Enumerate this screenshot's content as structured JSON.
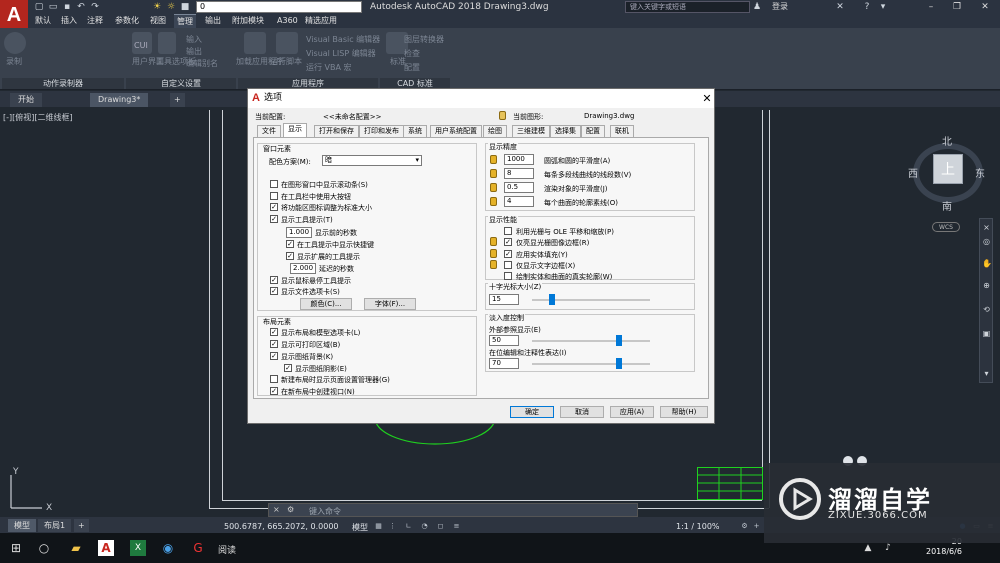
{
  "titlebar": {
    "app_title": "Autodesk AutoCAD 2018    Drawing3.dwg",
    "layer_value": "0",
    "search_placeholder": "键入关键字或短语",
    "login": "登录"
  },
  "ribbon": {
    "tabs": [
      "默认",
      "插入",
      "注释",
      "参数化",
      "视图",
      "管理",
      "输出",
      "附加模块",
      "A360",
      "精选应用"
    ],
    "active_tab": "管理",
    "items": {
      "record": "录制",
      "cui": "CUI",
      "user_interface": "用户界面",
      "tool_palettes": "工具选项板",
      "import": "输入",
      "export": "输出",
      "edit_aliases": "编辑别名",
      "load_app": "加载应用程序",
      "run_script": "运行脚本",
      "vb_editor": "Visual Basic 编辑器",
      "lisp_editor": "Visual LISP 编辑器",
      "run_vba": "运行 VBA 宏",
      "standards": "标准",
      "configure": "配置",
      "layer_translator": "图层转换器",
      "check": "检查"
    },
    "groups": [
      "动作录制器",
      "自定义设置",
      "应用程序",
      "CAD 标准"
    ]
  },
  "doc_tabs": [
    "开始",
    "Drawing3*"
  ],
  "viewport_label": "[-][俯视][二维线框]",
  "viewcube": {
    "face": "上",
    "north": "北",
    "south": "南",
    "east": "东",
    "west": "西",
    "wcs": "WCS"
  },
  "dialog": {
    "title": "选项",
    "current_profile_label": "当前配置:",
    "current_profile_value": "<<未命名配置>>",
    "current_drawing_label": "当前图形:",
    "current_drawing_value": "Drawing3.dwg",
    "tabs": [
      "文件",
      "显示",
      "打开和保存",
      "打印和发布",
      "系统",
      "用户系统配置",
      "绘图",
      "三维建模",
      "选择集",
      "配置",
      "联机"
    ],
    "active_tab": "显示",
    "window_elements": {
      "title": "窗口元素",
      "color_scheme_label": "配色方案(M):",
      "color_scheme_value": "暗",
      "checkboxes": [
        {
          "label": "在图形窗口中显示滚动条(S)",
          "checked": false
        },
        {
          "label": "在工具栏中使用大按钮",
          "checked": false
        },
        {
          "label": "将功能区图标调整为标准大小",
          "checked": true
        },
        {
          "label": "显示工具提示(T)",
          "checked": true
        }
      ],
      "tooltip_delay_value": "1.000",
      "tooltip_delay_label": "显示前的秒数",
      "show_shortcut": {
        "label": "在工具提示中显示快捷键",
        "checked": true
      },
      "show_extended": {
        "label": "显示扩展的工具提示",
        "checked": true
      },
      "extended_delay_value": "2.000",
      "extended_delay_label": "延迟的秒数",
      "rollover": {
        "label": "显示鼠标悬停工具提示",
        "checked": true
      },
      "file_tabs": {
        "label": "显示文件选项卡(S)",
        "checked": true
      },
      "colors_button": "颜色(C)...",
      "fonts_button": "字体(F)..."
    },
    "layout_elements": {
      "title": "布局元素",
      "checkboxes": [
        {
          "label": "显示布局和模型选项卡(L)",
          "checked": true
        },
        {
          "label": "显示可打印区域(B)",
          "checked": true
        },
        {
          "label": "显示图纸背景(K)",
          "checked": true
        }
      ],
      "paper_shadow": {
        "label": "显示图纸阴影(E)",
        "checked": true
      },
      "page_setup_mgr": {
        "label": "新建布局时显示页面设置管理器(G)",
        "checked": false
      },
      "create_viewport": {
        "label": "在新布局中创建视口(N)",
        "checked": true
      }
    },
    "display_resolution": {
      "title": "显示精度",
      "rows": [
        {
          "value": "1000",
          "label": "圆弧和圆的平滑度(A)"
        },
        {
          "value": "8",
          "label": "每条多段线曲线的线段数(V)"
        },
        {
          "value": "0.5",
          "label": "渲染对象的平滑度(J)"
        },
        {
          "value": "4",
          "label": "每个曲面的轮廓素线(O)"
        }
      ]
    },
    "display_performance": {
      "title": "显示性能",
      "checkboxes": [
        {
          "label": "利用光栅与 OLE 平移和缩放(P)",
          "checked": false
        },
        {
          "label": "仅亮显光栅图像边框(R)",
          "checked": true
        },
        {
          "label": "应用实体填充(Y)",
          "checked": true
        },
        {
          "label": "仅显示文字边框(X)",
          "checked": false
        },
        {
          "label": "绘制实体和曲面的真实轮廓(W)",
          "checked": false
        }
      ]
    },
    "crosshair": {
      "title": "十字光标大小(Z)",
      "value": "15",
      "fraction": 0.15
    },
    "fade": {
      "title": "淡入度控制",
      "xref_label": "外部参照显示(E)",
      "xref_value": "50",
      "xref_fraction": 0.75,
      "inplace_label": "在位编辑和注释性表达(I)",
      "inplace_value": "70",
      "inplace_fraction": 0.75
    },
    "buttons": {
      "ok": "确定",
      "cancel": "取消",
      "apply": "应用(A)",
      "help": "帮助(H)"
    }
  },
  "command_placeholder": "键入命令",
  "layout_tabs": [
    "模型",
    "布局1"
  ],
  "status": {
    "coords": "500.6787, 665.2072, 0.0000",
    "model": "模型",
    "scale": "1:1 / 100%"
  },
  "taskbar": {
    "time": "20",
    "date": "2018/6/6",
    "reading_app": "阅读"
  },
  "watermark": {
    "title": "溜溜自学",
    "subtitle": "ZIXUE.3066.COM"
  },
  "colors": {
    "accent": "#0078d7",
    "logo_red": "#b3261e",
    "drawing_bg": "#212830",
    "circle_green": "#1fd11f"
  }
}
